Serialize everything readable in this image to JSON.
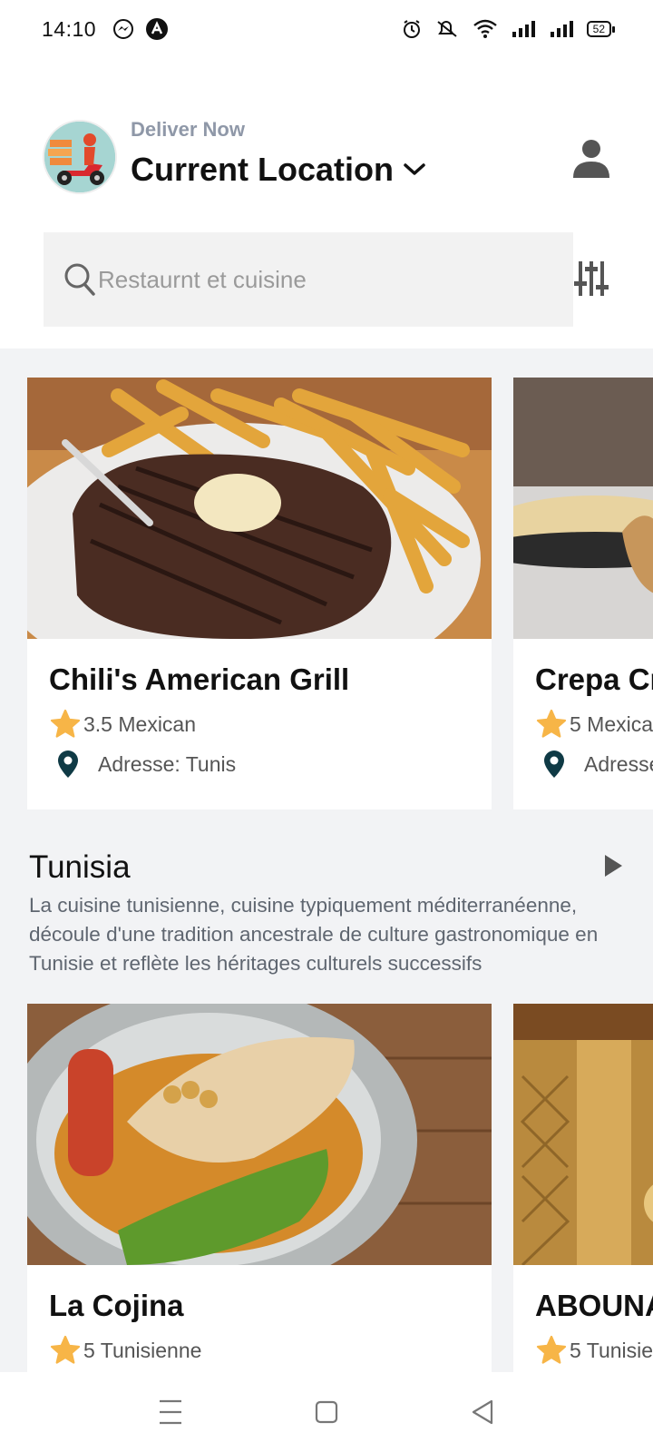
{
  "status_bar": {
    "time": "14:10",
    "battery": "52",
    "icons": [
      "messenger-icon",
      "app-a-icon",
      "alarm-icon",
      "mute-icon",
      "wifi-icon",
      "signal-icon",
      "signal-icon",
      "battery-icon"
    ]
  },
  "header": {
    "deliver_label": "Deliver Now",
    "location_title": "Current Location",
    "profile_icon": "user-icon"
  },
  "search": {
    "placeholder": "Restaurnt et cuisine",
    "filter_icon": "sliders-icon"
  },
  "featured": [
    {
      "name": "Chili's American Grill",
      "rating_line": "3.5 Mexican",
      "address": "Adresse: Tunis"
    },
    {
      "name": "Crepa Cr",
      "rating_line": "5 Mexica",
      "address": "Adresse"
    }
  ],
  "section": {
    "title": "Tunisia",
    "description": "La cuisine tunisienne, cuisine typiquement méditerranéenne, découle d'une tradition ancestrale de culture gastronomique en Tunisie et reflète les héritages culturels successifs"
  },
  "tunisia_restaurants": [
    {
      "name": "La Cojina",
      "rating_line": "5 Tunisienne"
    },
    {
      "name": "ABOUNA",
      "rating_line": "5 Tunisie"
    }
  ],
  "colors": {
    "star": "#f7b547",
    "pin": "#0f3a45",
    "label_gray": "#8f98a8",
    "background": "#f2f3f5"
  },
  "nav": {
    "buttons": [
      "menu-icon",
      "home-square-icon",
      "back-triangle-icon"
    ]
  }
}
